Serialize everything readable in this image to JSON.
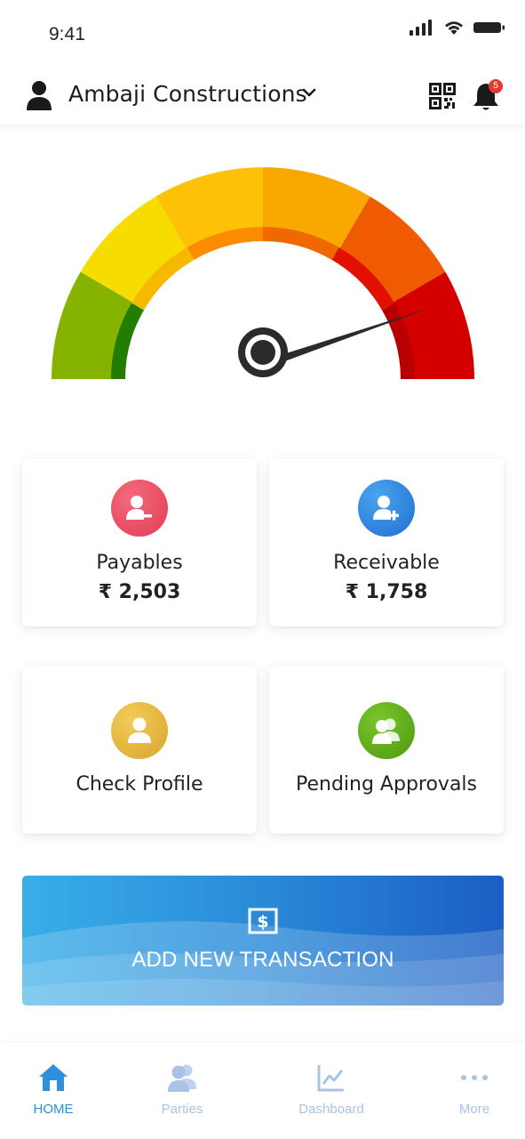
{
  "status_bar": {
    "time": "9:41"
  },
  "header": {
    "company_name": "Ambaji Constructions",
    "notification_count": "5"
  },
  "gauge": {
    "needle_level": 0.87
  },
  "cards": [
    {
      "label": "Payables",
      "value": "₹ 2,503",
      "color": "#e8485f"
    },
    {
      "label": "Receivable",
      "value": "₹ 1,758",
      "color": "#2a7fdc"
    },
    {
      "label": "Check Profile",
      "color": "#e2b13a"
    },
    {
      "label": "Pending Approvals",
      "color": "#5fa81e"
    }
  ],
  "transaction_button": {
    "label": "ADD NEW TRANSACTION"
  },
  "bottom_nav": [
    {
      "label": "HOME",
      "icon": "home-icon",
      "active": true
    },
    {
      "label": "Parties",
      "icon": "users-icon",
      "active": false
    },
    {
      "label": "Dashboard",
      "icon": "chart-icon",
      "active": false
    },
    {
      "label": "More",
      "icon": "more-dots-icon",
      "active": false
    }
  ],
  "colors": {
    "nav_active": "#2e8fdc",
    "nav_inactive": "#a9c3e6",
    "gauge_red": "#d40000",
    "gauge_green": "#8ab200"
  }
}
